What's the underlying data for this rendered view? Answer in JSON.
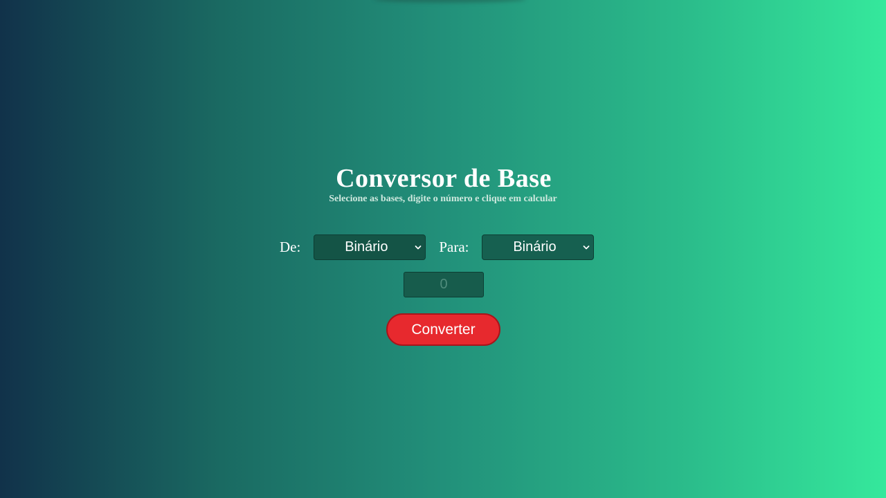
{
  "header": {
    "title": "Conversor de Base",
    "subtitle": "Selecione as bases, digite o número e clique em calcular"
  },
  "form": {
    "from_label": "De:",
    "from_value": "Binário",
    "to_label": "Para:",
    "to_value": "Binário",
    "number_placeholder": "0",
    "number_value": "",
    "convert_label": "Converter"
  },
  "colors": {
    "accent_button": "#e7292e",
    "background_start": "#11324a",
    "background_end": "#35e89c"
  },
  "icons": {
    "select_arrow": "chevron-down-icon"
  }
}
